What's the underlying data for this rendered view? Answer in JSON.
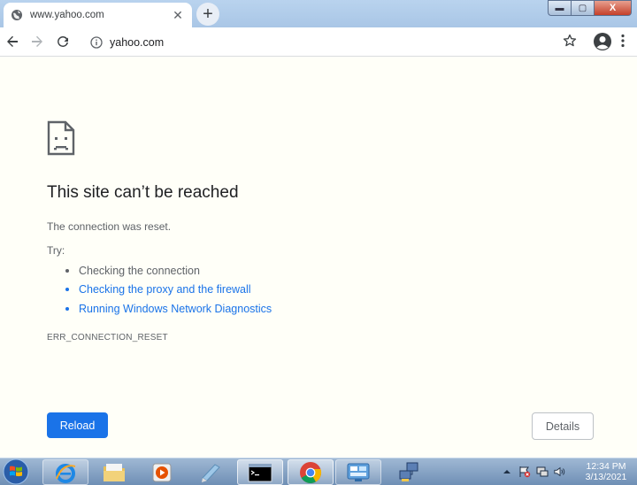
{
  "browser": {
    "tab": {
      "title": "www.yahoo.com",
      "close_glyph": "✕"
    },
    "new_tab_glyph": "+",
    "window_controls": {
      "minimize": "▬",
      "maximize": "▢",
      "close": "X"
    },
    "address": {
      "url": "yahoo.com"
    }
  },
  "error_page": {
    "title": "This site can’t be reached",
    "description": "The connection was reset.",
    "try_label": "Try:",
    "suggestions": [
      {
        "text": "Checking the connection",
        "link": false
      },
      {
        "text": "Checking the proxy and the firewall",
        "link": true
      },
      {
        "text": "Running Windows Network Diagnostics",
        "link": true
      }
    ],
    "error_code": "ERR_CONNECTION_RESET",
    "reload_label": "Reload",
    "details_label": "Details"
  },
  "taskbar": {
    "apps": [
      "internet-explorer",
      "file-explorer",
      "media-player",
      "notepad",
      "command-prompt",
      "chrome",
      "control-panel",
      "network"
    ],
    "clock": {
      "time": "12:34 PM",
      "date": "3/13/2021"
    }
  },
  "colors": {
    "accent": "#1a73e8",
    "page_bg": "#fffff8",
    "titlebar": "#b9d3ee"
  }
}
